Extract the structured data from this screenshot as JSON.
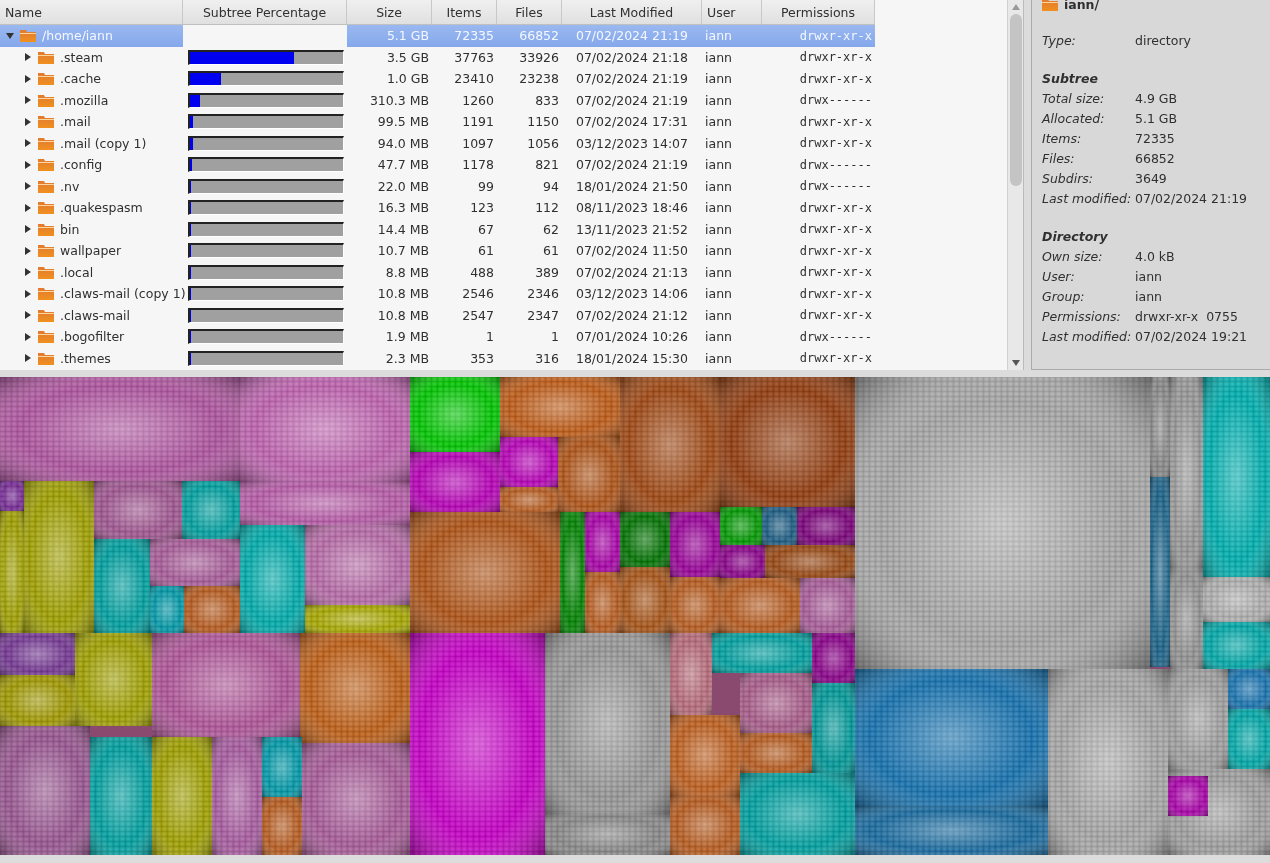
{
  "tree": {
    "columns": [
      {
        "label": "Name"
      },
      {
        "label": "Subtree Percentage"
      },
      {
        "label": "Size"
      },
      {
        "label": "Items"
      },
      {
        "label": "Files"
      },
      {
        "label": "Last Modified"
      },
      {
        "label": "User"
      },
      {
        "label": "Permissions"
      }
    ],
    "rows": [
      {
        "name": "/home/iann",
        "size": "5.1 GB",
        "items": "72335",
        "files": "66852",
        "modified": "07/02/2024 21:19",
        "user": "iann",
        "permissions": "drwxr-xr-x",
        "expanded": true,
        "selected": true,
        "children": [
          {
            "name": ".steam",
            "level": 0.68,
            "size": "3.5 GB",
            "items": "37763",
            "files": "33926",
            "modified": "07/02/2024 21:18",
            "user": "iann",
            "permissions": "drwxr-xr-x",
            "expanded": false,
            "selected": false
          },
          {
            "name": ".cache",
            "level": 0.2,
            "size": "1.0 GB",
            "items": "23410",
            "files": "23238",
            "modified": "07/02/2024 21:19",
            "user": "iann",
            "permissions": "drwxr-xr-x",
            "expanded": false,
            "selected": false
          },
          {
            "name": ".mozilla",
            "level": 0.065,
            "size": "310.3 MB",
            "items": "1260",
            "files": "833",
            "modified": "07/02/2024 21:19",
            "user": "iann",
            "permissions": "drwx------",
            "expanded": false,
            "selected": false
          },
          {
            "name": ".mail",
            "level": 0.022,
            "size": "99.5 MB",
            "items": "1191",
            "files": "1150",
            "modified": "07/02/2024 17:31",
            "user": "iann",
            "permissions": "drwxr-xr-x",
            "expanded": false,
            "selected": false
          },
          {
            "name": ".mail (copy 1)",
            "level": 0.02,
            "size": "94.0 MB",
            "items": "1097",
            "files": "1056",
            "modified": "03/12/2023 14:07",
            "user": "iann",
            "permissions": "drwxr-xr-x",
            "expanded": false,
            "selected": false
          },
          {
            "name": ".config",
            "level": 0.012,
            "size": "47.7 MB",
            "items": "1178",
            "files": "821",
            "modified": "07/02/2024 21:19",
            "user": "iann",
            "permissions": "drwx------",
            "expanded": false,
            "selected": false
          },
          {
            "name": ".nv",
            "level": 0.005,
            "size": "22.0 MB",
            "items": "99",
            "files": "94",
            "modified": "18/01/2024 21:50",
            "user": "iann",
            "permissions": "drwx------",
            "expanded": false,
            "selected": false
          },
          {
            "name": ".quakespasm",
            "level": 0.004,
            "size": "16.3 MB",
            "items": "123",
            "files": "112",
            "modified": "08/11/2023 18:46",
            "user": "iann",
            "permissions": "drwxr-xr-x",
            "expanded": false,
            "selected": false
          },
          {
            "name": "bin",
            "level": 0.004,
            "size": "14.4 MB",
            "items": "67",
            "files": "62",
            "modified": "13/11/2023 21:52",
            "user": "iann",
            "permissions": "drwxr-xr-x",
            "expanded": false,
            "selected": false
          },
          {
            "name": "wallpaper",
            "level": 0.003,
            "size": "10.7 MB",
            "items": "61",
            "files": "61",
            "modified": "07/02/2024 11:50",
            "user": "iann",
            "permissions": "drwxr-xr-x",
            "expanded": false,
            "selected": false
          },
          {
            "name": ".local",
            "level": 0.003,
            "size": "8.8 MB",
            "items": "488",
            "files": "389",
            "modified": "07/02/2024 21:13",
            "user": "iann",
            "permissions": "drwxr-xr-x",
            "expanded": false,
            "selected": false
          },
          {
            "name": ".claws-mail (copy 1)",
            "level": 0.003,
            "size": "10.8 MB",
            "items": "2546",
            "files": "2346",
            "modified": "03/12/2023 14:06",
            "user": "iann",
            "permissions": "drwxr-xr-x",
            "expanded": false,
            "selected": false
          },
          {
            "name": ".claws-mail",
            "level": 0.003,
            "size": "10.8 MB",
            "items": "2547",
            "files": "2347",
            "modified": "07/02/2024 21:12",
            "user": "iann",
            "permissions": "drwxr-xr-x",
            "expanded": false,
            "selected": false
          },
          {
            "name": ".bogofilter",
            "level": 0.002,
            "size": "1.9 MB",
            "items": "1",
            "files": "1",
            "modified": "07/01/2024 10:26",
            "user": "iann",
            "permissions": "drwx------",
            "expanded": false,
            "selected": false
          },
          {
            "name": ".themes",
            "level": 0.002,
            "size": "2.3 MB",
            "items": "353",
            "files": "316",
            "modified": "18/01/2024 15:30",
            "user": "iann",
            "permissions": "drwxr-xr-x",
            "expanded": false,
            "selected": false
          }
        ]
      }
    ]
  },
  "details": {
    "title": "iann/",
    "fields": [
      {
        "label": "Type:",
        "value": "directory"
      }
    ],
    "sections": [
      {
        "heading": "Subtree",
        "fields": [
          {
            "label": "Total size:",
            "value": "4.9 GB"
          },
          {
            "label": "Allocated:",
            "value": "5.1 GB"
          },
          {
            "label": "Items:",
            "value": "72335"
          },
          {
            "label": "Files:",
            "value": "66852"
          },
          {
            "label": "Subdirs:",
            "value": "3649"
          },
          {
            "label": "Last modified:",
            "value": "07/02/2024 21:19"
          }
        ]
      },
      {
        "heading": "Directory",
        "fields": [
          {
            "label": "Own size:",
            "value": "4.0 kB"
          },
          {
            "label": "User:",
            "value": "iann"
          },
          {
            "label": "Group:",
            "value": "iann"
          },
          {
            "label": "Permissions:",
            "value": "drwxr-xr-x  0755"
          },
          {
            "label": "Last modified:",
            "value": "07/02/2024 19:21"
          }
        ]
      }
    ]
  }
}
